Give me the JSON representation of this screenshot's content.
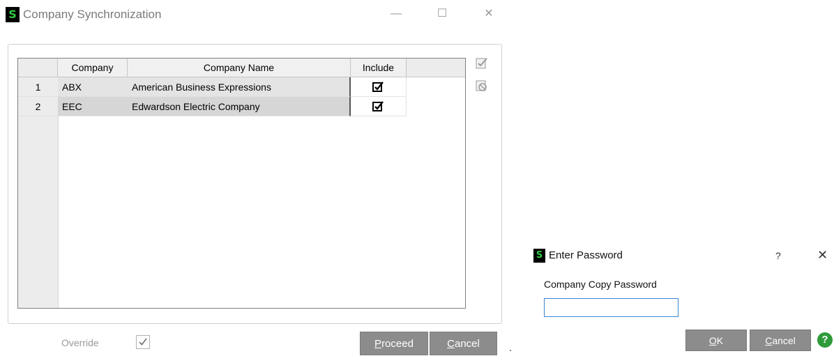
{
  "main_window": {
    "app_icon_letter": "S",
    "title": "Company Synchronization",
    "controls": {
      "minimize": "—",
      "maximize": "☐",
      "close": "✕"
    },
    "grid": {
      "headers": {
        "company": "Company",
        "company_name": "Company Name",
        "include": "Include"
      },
      "rows": [
        {
          "num": "1",
          "company": "ABX",
          "company_name": "American Business Expressions",
          "include": true
        },
        {
          "num": "2",
          "company": "EEC",
          "company_name": "Edwardson Electric Company",
          "include": true
        }
      ]
    },
    "side_icons": [
      "check-all-icon",
      "clear-all-icon"
    ],
    "override": {
      "label": "Override",
      "checked": true
    },
    "buttons": {
      "proceed_prefix": "P",
      "proceed_rest": "roceed",
      "cancel_prefix": "C",
      "cancel_rest": "ancel"
    }
  },
  "password_dialog": {
    "app_icon_letter": "S",
    "title": "Enter Password",
    "help_mark": "?",
    "close": "✕",
    "field_label": "Company Copy Password",
    "field_value": "",
    "buttons": {
      "ok_prefix": "O",
      "ok_rest": "K",
      "cancel_prefix": "C",
      "cancel_rest": "ancel"
    },
    "help_icon": "?"
  },
  "colors": {
    "button_gray": "#8c8c8c",
    "focus_blue": "#3a86d4",
    "help_green": "#2e9b3a",
    "logo_green": "#2ecc40"
  }
}
